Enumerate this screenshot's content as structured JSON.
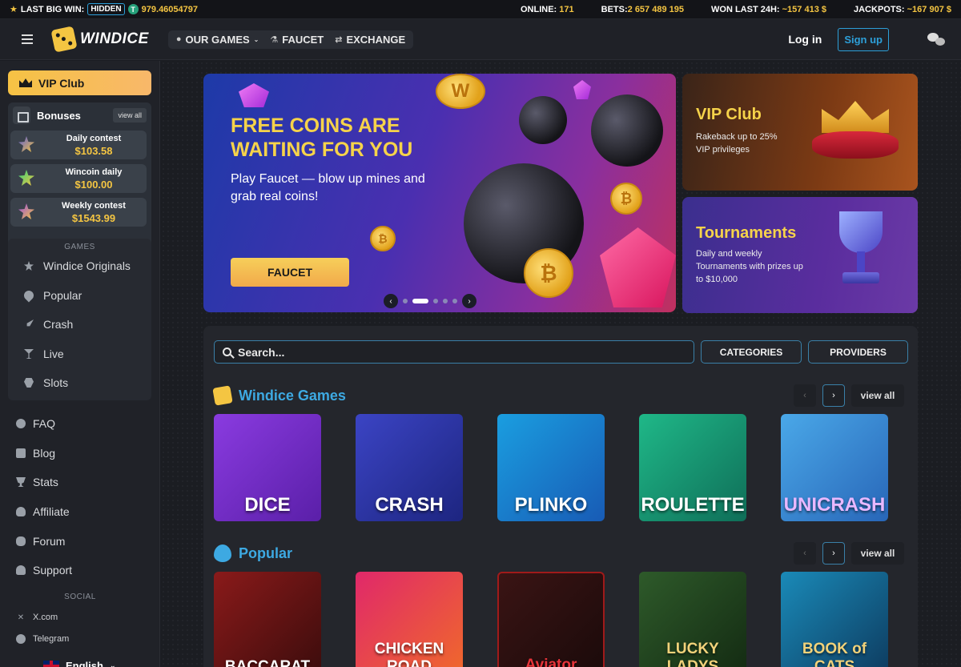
{
  "ticker": {
    "last_big_win_label": "LAST BIG WIN:",
    "hidden_badge": "HIDDEN",
    "win_amount": "979.46054797",
    "online_label": "ONLINE:",
    "online_value": "171",
    "bets_label": "BETS:",
    "bets_value": "2 657 489 195",
    "won_label": "WON LAST 24H:",
    "won_value": "~157 413 $",
    "jackpots_label": "JACKPOTS:",
    "jackpots_value": "~167 907 $"
  },
  "header": {
    "logo": "WINDICE",
    "nav": [
      {
        "label": "OUR GAMES",
        "icon": "gamepad-icon"
      },
      {
        "label": "FAUCET",
        "icon": "flask-icon"
      },
      {
        "label": "EXCHANGE",
        "icon": "exchange-icon"
      }
    ],
    "login": "Log in",
    "signup": "Sign up"
  },
  "sidebar": {
    "vip": "VIP Club",
    "bonuses_title": "Bonuses",
    "bonuses_view_all": "view all",
    "bonuses": [
      {
        "name": "Daily contest",
        "amount": "$103.58"
      },
      {
        "name": "Wincoin daily",
        "amount": "$100.00"
      },
      {
        "name": "Weekly contest",
        "amount": "$1543.99"
      }
    ],
    "games_label": "GAMES",
    "games": [
      "Windice Originals",
      "Popular",
      "Crash",
      "Live",
      "Slots"
    ],
    "links": [
      "FAQ",
      "Blog",
      "Stats",
      "Affiliate",
      "Forum",
      "Support"
    ],
    "social_label": "SOCIAL",
    "social": [
      "X.com",
      "Telegram"
    ],
    "language": "English"
  },
  "hero": {
    "title": "FREE COINS ARE WAITING FOR YOU",
    "description": "Play Faucet — blow up mines and grab real coins!",
    "button": "FAUCET",
    "slide_count": 5,
    "active_slide": 2
  },
  "promos": {
    "vip": {
      "title": "VIP Club",
      "desc": "Rakeback up to 25% VIP privileges"
    },
    "tournaments": {
      "title": "Tournaments",
      "desc": "Daily and weekly Tournaments with prizes up to $10,000"
    }
  },
  "search": {
    "placeholder": "Search..."
  },
  "filters": {
    "categories": "CATEGORIES",
    "providers": "PROVIDERS"
  },
  "sections": {
    "windice_games": {
      "title": "Windice Games",
      "view_all": "view all",
      "games": [
        "DICE",
        "CRASH",
        "PLINKO",
        "ROULETTE",
        "UNICRASH"
      ]
    },
    "popular": {
      "title": "Popular",
      "view_all": "view all",
      "games": [
        "BACCARAT",
        "CHICKEN ROAD",
        "Aviator",
        "LUCKY LADYS",
        "BOOK of CATS"
      ]
    }
  },
  "colors": {
    "accent": "#2d9fd8",
    "gold": "#f4c542",
    "section_title": "#3da9e2"
  }
}
